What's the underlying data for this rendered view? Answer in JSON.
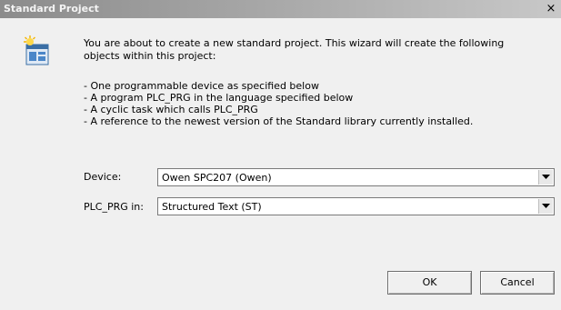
{
  "window": {
    "title": "Standard Project",
    "close_glyph": "×"
  },
  "icon": {
    "name": "new-project-wizard-icon"
  },
  "intro_text": "You are about to create a new standard project. This wizard will create the following objects within this project:",
  "bullets": [
    "- One programmable device as specified below",
    "- A program PLC_PRG in the language specified below",
    "- A cyclic task which calls PLC_PRG",
    "- A reference to the newest version of the Standard library currently installed."
  ],
  "device": {
    "label": "Device:",
    "value": "Owen SPC207 (Owen)"
  },
  "plc_prg": {
    "label": "PLC_PRG in:",
    "value": "Structured Text (ST)"
  },
  "buttons": {
    "ok": "OK",
    "cancel": "Cancel"
  },
  "colors": {
    "dialog_bg": "#f0f0f0",
    "titlebar": "#a9a9a9"
  }
}
